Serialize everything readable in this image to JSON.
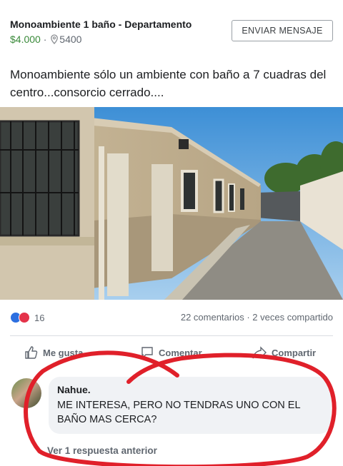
{
  "listing": {
    "title": "Monoambiente 1 baño - Departamento",
    "price": "$4.000",
    "separator": " · ",
    "location": "5400",
    "message_button": "ENVIAR MENSAJE",
    "description": "Monoambiente sólo un ambiente con baño a 7 cuadras del centro...consorcio cerrado...."
  },
  "stats": {
    "reactions_count": "16",
    "comments_shares": "22 comentarios · 2 veces compartido"
  },
  "actions": {
    "like": "Me gusta",
    "comment": "Comentar",
    "share": "Compartir"
  },
  "comment": {
    "author": "Nahue.",
    "text": "ME INTERESA, PERO NO TENDRAS UNO CON EL BAÑO MAS CERCA?",
    "previous_replies": "Ver 1 respuesta anterior"
  },
  "icons": [
    "location-pin-icon",
    "like-reaction-icon",
    "love-reaction-icon",
    "thumbs-up-icon",
    "comment-icon",
    "share-icon"
  ],
  "colors": {
    "price": "#3a8a3a",
    "like": "#2d6fe0",
    "love": "#e4334a",
    "annotation": "#e0202a"
  }
}
